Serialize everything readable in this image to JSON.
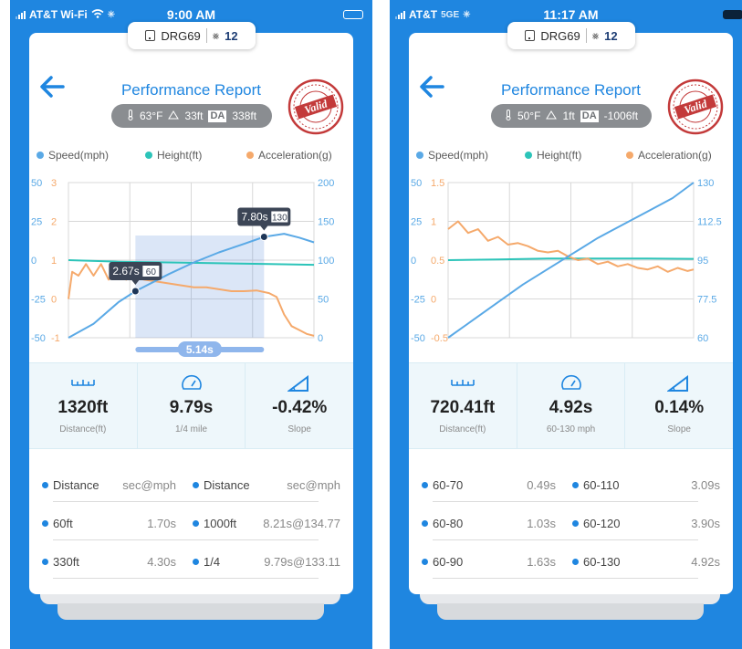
{
  "colors": {
    "brand": "#1f86e0",
    "speed": "#5aa9e6",
    "height": "#2cc4b9",
    "accel": "#f5a96b",
    "grid": "#d8d8d8"
  },
  "screens": [
    {
      "status": {
        "carrier": "AT&T Wi-Fi",
        "time": "9:00 AM",
        "extra": ""
      },
      "device": {
        "name": "DRG69",
        "sat_count": "12"
      },
      "title": "Performance Report",
      "conditions": {
        "temp": "63°F",
        "alt": "33ft",
        "da_label": "DA",
        "da": "338ft"
      },
      "stamp": "Valid",
      "legend": {
        "speed": "Speed(mph)",
        "height": "Height(ft)",
        "accel": "Acceleration(g)"
      },
      "axes": {
        "left_outer": [
          "50",
          "25",
          "0",
          "-25",
          "-50"
        ],
        "left_inner": [
          "3",
          "2",
          "1",
          "0",
          "-1"
        ],
        "right": [
          "200",
          "150",
          "100",
          "50",
          "0"
        ]
      },
      "chart_data": {
        "type": "line",
        "x_unit": "s",
        "selection": {
          "start": 2.67,
          "end": 7.8,
          "duration_label": "5.14s"
        },
        "markers": [
          {
            "time_label": "2.67s",
            "value_label": "60"
          },
          {
            "time_label": "7.80s",
            "value_label": "130"
          }
        ],
        "series": [
          {
            "name": "Speed(mph)",
            "axis": "right",
            "x": [
              0,
              1,
              2,
              2.67,
              4,
              5,
              6,
              7,
              7.8,
              8.6,
              9.2,
              9.79
            ],
            "values": [
              0,
              18,
              46,
              60,
              82,
              97,
              110,
              121,
              130,
              134,
              129,
              123
            ]
          },
          {
            "name": "Height(ft)",
            "axis": "left_outer",
            "x": [
              0,
              2,
              4,
              6,
              8,
              9.79
            ],
            "values": [
              0,
              -1,
              -1.5,
              -2,
              -2.5,
              -3
            ]
          },
          {
            "name": "Acceleration(g)",
            "axis": "left_inner",
            "x": [
              0,
              0.15,
              0.4,
              0.7,
              1,
              1.3,
              1.6,
              2,
              2.3,
              2.67,
              3,
              3.5,
              4,
              4.5,
              5,
              5.5,
              6,
              6.5,
              7,
              7.5,
              8,
              8.3,
              8.6,
              8.9,
              9.2,
              9.5,
              9.79
            ],
            "values": [
              0,
              0.7,
              0.6,
              0.9,
              0.6,
              0.9,
              0.5,
              0.7,
              0.5,
              0.6,
              0.5,
              0.45,
              0.4,
              0.35,
              0.3,
              0.3,
              0.25,
              0.2,
              0.2,
              0.22,
              0.15,
              0.05,
              -0.4,
              -0.7,
              -0.8,
              -0.9,
              -0.95
            ]
          }
        ]
      },
      "stats": [
        {
          "value": "1320ft",
          "label": "Distance(ft)"
        },
        {
          "value": "9.79s",
          "label": "1/4 mile"
        },
        {
          "value": "-0.42%",
          "label": "Slope"
        }
      ],
      "table": {
        "header": [
          "Distance",
          "sec@mph",
          "Distance",
          "sec@mph"
        ],
        "rows": [
          [
            "60ft",
            "1.70s",
            "1000ft",
            "8.21s@134.77"
          ],
          [
            "330ft",
            "4.30s",
            "1/4",
            "9.79s@133.11"
          ]
        ]
      }
    },
    {
      "status": {
        "carrier": "AT&T",
        "time": "11:17 AM",
        "extra": "5GE"
      },
      "device": {
        "name": "DRG69",
        "sat_count": "12"
      },
      "title": "Performance Report",
      "conditions": {
        "temp": "50°F",
        "alt": "1ft",
        "da_label": "DA",
        "da": "-1006ft"
      },
      "stamp": "Valid",
      "legend": {
        "speed": "Speed(mph)",
        "height": "Height(ft)",
        "accel": "Acceleration(g)"
      },
      "axes": {
        "left_outer": [
          "50",
          "25",
          "0",
          "-25",
          "-50"
        ],
        "left_inner": [
          "1.5",
          "1",
          "0.5",
          "0",
          "-0.5"
        ],
        "right": [
          "130",
          "112.5",
          "95",
          "77.5",
          "60"
        ]
      },
      "chart_data": {
        "type": "line",
        "x_unit": "s",
        "series": [
          {
            "name": "Speed(mph)",
            "axis": "right",
            "x": [
              0,
              0.5,
              1,
              1.5,
              2,
              2.5,
              3,
              3.5,
              4,
              4.5,
              4.92
            ],
            "values": [
              60,
              68,
              76,
              84,
              91,
              98,
              105,
              111,
              117,
              123,
              130
            ]
          },
          {
            "name": "Height(ft)",
            "axis": "left_outer",
            "x": [
              0,
              1,
              2,
              3,
              4,
              4.92
            ],
            "values": [
              0,
              0.5,
              1,
              1,
              1,
              0.8
            ]
          },
          {
            "name": "Acceleration(g)",
            "axis": "left_inner",
            "x": [
              0,
              0.2,
              0.4,
              0.6,
              0.8,
              1,
              1.2,
              1.4,
              1.6,
              1.8,
              2,
              2.2,
              2.4,
              2.6,
              2.8,
              3,
              3.2,
              3.4,
              3.6,
              3.8,
              4,
              4.2,
              4.4,
              4.6,
              4.8,
              4.92
            ],
            "values": [
              0.9,
              1.0,
              0.85,
              0.9,
              0.75,
              0.8,
              0.7,
              0.72,
              0.68,
              0.62,
              0.6,
              0.62,
              0.55,
              0.5,
              0.52,
              0.45,
              0.48,
              0.42,
              0.45,
              0.4,
              0.38,
              0.42,
              0.35,
              0.4,
              0.36,
              0.38
            ]
          }
        ]
      },
      "stats": [
        {
          "value": "720.41ft",
          "label": "Distance(ft)"
        },
        {
          "value": "4.92s",
          "label": "60-130 mph"
        },
        {
          "value": "0.14%",
          "label": "Slope"
        }
      ],
      "table": {
        "header": [],
        "rows": [
          [
            "60-70",
            "0.49s",
            "60-110",
            "3.09s"
          ],
          [
            "60-80",
            "1.03s",
            "60-120",
            "3.90s"
          ],
          [
            "60-90",
            "1.63s",
            "60-130",
            "4.92s"
          ]
        ]
      }
    }
  ]
}
